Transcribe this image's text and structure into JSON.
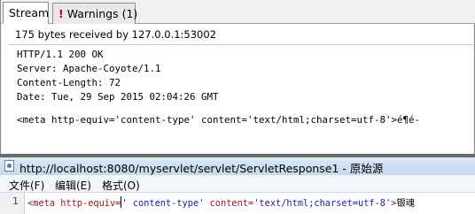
{
  "tabs": {
    "stream_label": "Stream",
    "warnings_icon": "!",
    "warnings_label": "Warnings (1)"
  },
  "stream": {
    "status": "175 bytes received by 127.0.0.1:53002",
    "lines": [
      "HTTP/1.1 200 OK",
      "Server: Apache-Coyote/1.1",
      "Content-Length: 72",
      "Date: Tue, 29 Sep 2015 02:04:26 GMT",
      "<meta http-equiv='content-type' content='text/html;charset=utf-8'>é¶é-"
    ]
  },
  "source_window": {
    "title": "http://localhost:8080/myservlet/servlet/ServletResponse1 - 原始源",
    "menu": [
      "文件(F)",
      "编辑(E)",
      "格式(O)"
    ],
    "line_number": "1",
    "code": {
      "tag_open": "<meta ",
      "attr1": "http-equiv=",
      "val1": "' content-type'",
      "space": " ",
      "attr2": "content=",
      "val2": "'text/html;charset=utf-8'",
      "tag_close": ">",
      "text": "银魂"
    }
  }
}
